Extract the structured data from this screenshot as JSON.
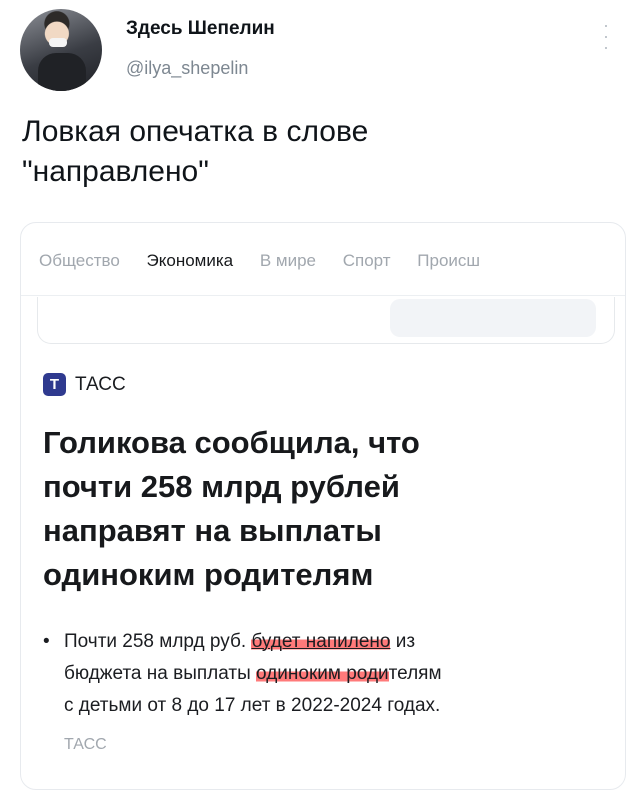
{
  "tweet": {
    "author_name": "Здесь Шепелин",
    "author_handle": "@ilya_shepelin",
    "text_line1": "Ловкая опечатка в слове",
    "text_line2": "\"направлено\"",
    "more_icon": "more-vertical-icon"
  },
  "card": {
    "tabs": [
      "Общество",
      "Экономика",
      "В мире",
      "Спорт",
      "Происш"
    ],
    "active_tab": "Экономика",
    "source": {
      "logo_letter": "Т",
      "name": "ТАСС"
    },
    "headline_lines": [
      "Голикова сообщила, что",
      "почти 258 млрд рублей",
      "направят на выплаты",
      "одиноким родителям"
    ],
    "bullet": {
      "l1_pre": "Почти 258 млрд руб. ",
      "l1_hl": "будет напилено",
      "l1_post": " из",
      "l2_pre": "бюджета на выплаты ",
      "l2_hl": "одиноким роди",
      "l2_post": "телям",
      "l3": "с детьми от 8 до 17 лет в 2022-2024 годах."
    },
    "bullet_source": "ТАСС"
  },
  "colors": {
    "highlight": "#ff5454",
    "tass_logo": "#2f3a8f",
    "muted": "#a1a7ae"
  }
}
